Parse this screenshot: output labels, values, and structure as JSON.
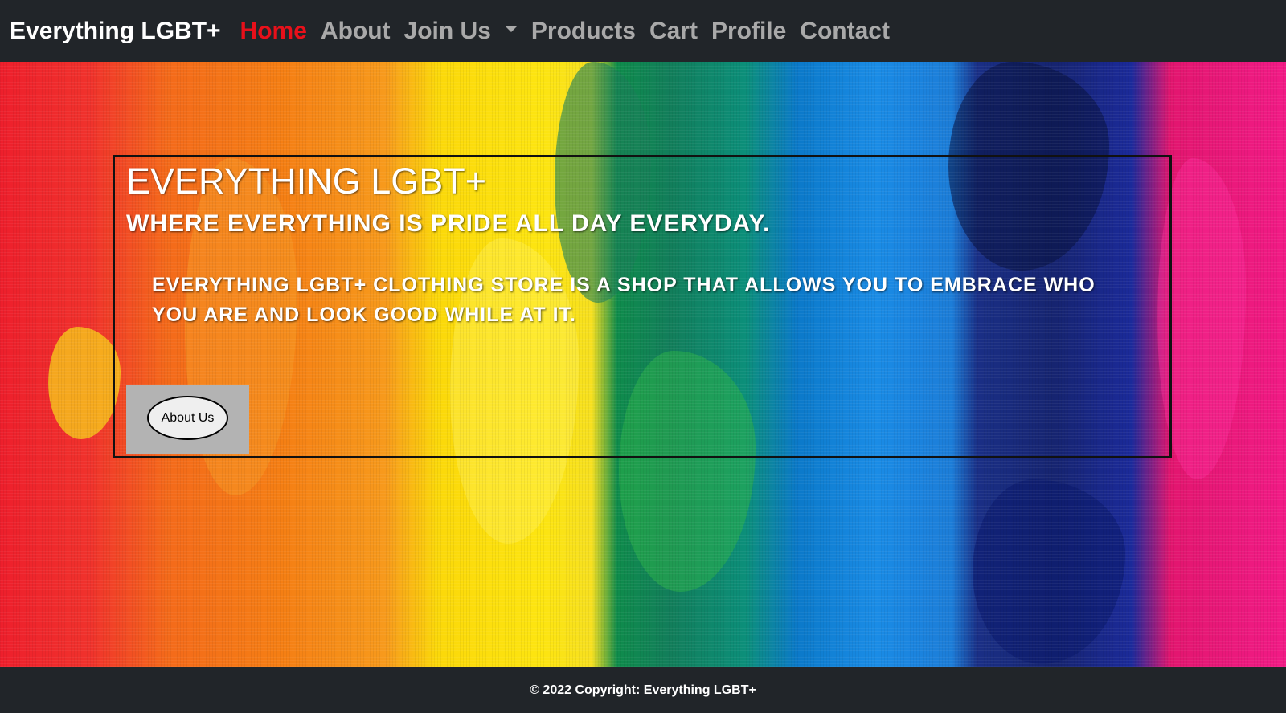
{
  "navbar": {
    "brand": "Everything LGBT+",
    "links": [
      {
        "label": "Home",
        "active": true
      },
      {
        "label": "About"
      },
      {
        "label": "Join Us",
        "dropdown": true
      },
      {
        "label": "Products"
      },
      {
        "label": "Cart"
      },
      {
        "label": "Profile"
      },
      {
        "label": "Contact"
      }
    ],
    "active_color": "#e8101a",
    "link_color": "#a9a9a9",
    "background": "#212529"
  },
  "hero": {
    "title": "EVERYTHING LGBT+",
    "subtitle": "WHERE EVERYTHING IS PRIDE ALL DAY EVERYDAY.",
    "description": "EVERYTHING LGBT+ CLOTHING STORE IS A SHOP THAT ALLOWS YOU TO EMBRACE WHO YOU ARE AND LOOK GOOD WHILE AT IT.",
    "button_label": "About Us",
    "background": "rainbow paint canvas"
  },
  "footer": {
    "text": "© 2022 Copyright: Everything LGBT+"
  },
  "icons": {
    "dropdown": "chevron-down-icon"
  }
}
